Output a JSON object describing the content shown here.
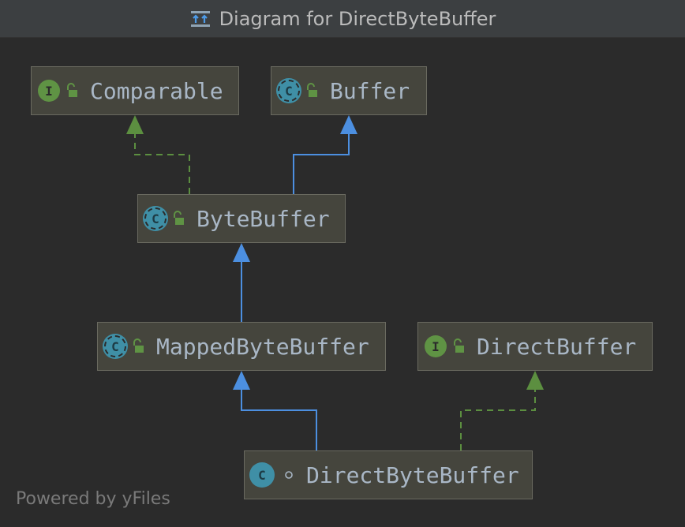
{
  "window": {
    "title": "Diagram for DirectByteBuffer"
  },
  "nodes": [
    {
      "id": "comparable",
      "kind": "I",
      "label": "Comparable",
      "access": "public"
    },
    {
      "id": "buffer",
      "kind": "C",
      "label": "Buffer",
      "access": "public",
      "abstract": true
    },
    {
      "id": "bytebuffer",
      "kind": "C",
      "label": "ByteBuffer",
      "access": "public",
      "abstract": true
    },
    {
      "id": "mappedbytebuffer",
      "kind": "C",
      "label": "MappedByteBuffer",
      "access": "public",
      "abstract": true
    },
    {
      "id": "directbuffer",
      "kind": "I",
      "label": "DirectBuffer",
      "access": "public"
    },
    {
      "id": "directbytebuffer",
      "kind": "C",
      "label": "DirectByteBuffer",
      "access": "package"
    }
  ],
  "edges": [
    {
      "from": "bytebuffer",
      "to": "comparable",
      "type": "implements",
      "color": "#5c8f40"
    },
    {
      "from": "bytebuffer",
      "to": "buffer",
      "type": "extends",
      "color": "#4c8fe0"
    },
    {
      "from": "mappedbytebuffer",
      "to": "bytebuffer",
      "type": "extends",
      "color": "#4c8fe0"
    },
    {
      "from": "directbytebuffer",
      "to": "mappedbytebuffer",
      "type": "extends",
      "color": "#4c8fe0"
    },
    {
      "from": "directbytebuffer",
      "to": "directbuffer",
      "type": "implements",
      "color": "#5c8f40"
    }
  ],
  "footer": {
    "text": "Powered by yFiles"
  },
  "colors": {
    "background": "#2b2b2b",
    "titlebar": "#3c3f41",
    "node_fill": "#45453d",
    "node_border": "#6a6a60",
    "label": "#a9b7c6",
    "interface_icon": "#5f9344",
    "class_icon": "#3f8fa6",
    "extends_edge": "#4c8fe0",
    "implements_edge": "#5c8f40"
  },
  "icons": {
    "title": "class-diagram-icon",
    "interface": "interface-icon",
    "class": "class-icon",
    "public": "unlocked-padlock-icon",
    "package": "package-private-dot-icon"
  }
}
